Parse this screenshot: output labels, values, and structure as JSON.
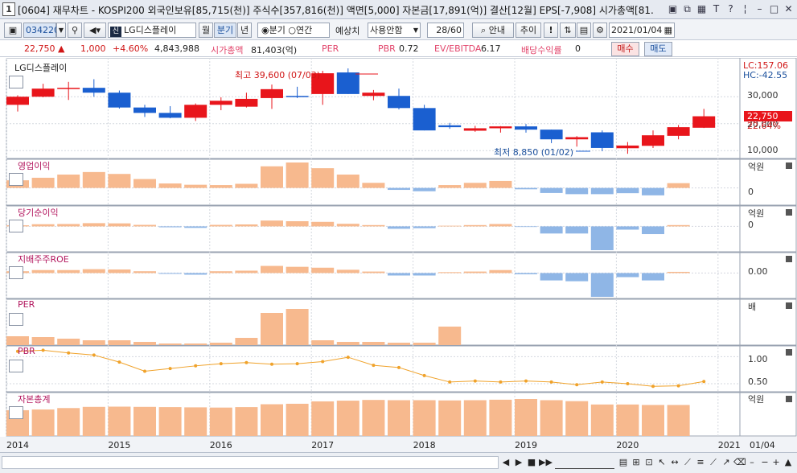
{
  "titlebar": {
    "window_number": "1",
    "title": "[0604] 재무차트 - KOSPI200 외국인보유[85,715(천)] 주식수[357,816(천)] 액면[5,000] 자본금[17,891(억)] 결산[12월] EPS[-7,908] 시가총액[81."
  },
  "toolbar": {
    "stock_code": "034220",
    "stock_name": "LG디스플레이",
    "period_month": "월",
    "period_quarter": "분기",
    "period_year": "년",
    "radio_quarter": "분기",
    "radio_year": "연간",
    "forecast_label": "예상치",
    "forecast_value": "사용안함",
    "count_value": "28",
    "count_total": "/60",
    "guide_label": "안내",
    "add_label": "추이",
    "date_value": "2021/01/04"
  },
  "infobar": {
    "price": "22,750",
    "change": "1,000",
    "change_pct": "+4.60%",
    "volume": "4,843,988",
    "mcap_label": "시가총액",
    "mcap_value": "81,403(억)",
    "per_label": "PER",
    "pbr_label": "PBR",
    "pbr_value": "0.72",
    "ev_label": "EV/EBITDA",
    "ev_value": "6.17",
    "div_label": "배당수익률",
    "div_value": "0",
    "buy_label": "매수",
    "sell_label": "매도"
  },
  "price_panel": {
    "title": "LG디스플레이",
    "lc_label": "LC:157.06",
    "hc_label": "HC:-42.55",
    "high_annotation": "최고 39,600 (07/03)",
    "low_annotation": "최저 8,850 (01/02)",
    "current_price_tag": "22,750",
    "current_pct_tag": "22.64%",
    "y_ticks": [
      "30,000",
      "20,000",
      "10,000"
    ]
  },
  "panels": [
    {
      "label": "영업이익",
      "unit": "억원",
      "zero": "0"
    },
    {
      "label": "당기순이익",
      "unit": "억원",
      "zero": "0"
    },
    {
      "label": "지배주주ROE",
      "unit": "",
      "zero": "0.00"
    },
    {
      "label": "PER",
      "unit": "배",
      "zero": ""
    },
    {
      "label": "PBR",
      "unit": "",
      "tick_hi": "1.00",
      "tick_lo": "0.50"
    },
    {
      "label": "자본총계",
      "unit": "억원",
      "zero": ""
    }
  ],
  "x_axis": [
    "2014",
    "2015",
    "2016",
    "2017",
    "2018",
    "2019",
    "2020",
    "2021"
  ],
  "x_axis_end": "01/04",
  "colors": {
    "up": "#e8151b",
    "down": "#1a5fd0",
    "bar_pos": "#f7b98e",
    "bar_neg": "#8fb6e6",
    "line": "#f0a22a"
  },
  "chart_data": [
    {
      "type": "candlestick",
      "title": "LG디스플레이 quarterly price",
      "categories": [
        "2014Q1",
        "2014Q2",
        "2014Q3",
        "2014Q4",
        "2015Q1",
        "2015Q2",
        "2015Q3",
        "2015Q4",
        "2016Q1",
        "2016Q2",
        "2016Q3",
        "2016Q4",
        "2017Q1",
        "2017Q2",
        "2017Q3",
        "2017Q4",
        "2018Q1",
        "2018Q2",
        "2018Q3",
        "2018Q4",
        "2019Q1",
        "2019Q2",
        "2019Q3",
        "2019Q4",
        "2020Q1",
        "2020Q2",
        "2020Q3",
        "2020Q4",
        "2021Q1"
      ],
      "ohlc": [
        [
          27000,
          30500,
          24500,
          30000
        ],
        [
          30000,
          34800,
          29800,
          33000
        ],
        [
          33000,
          35500,
          28800,
          33300
        ],
        [
          33300,
          36500,
          30000,
          31500
        ],
        [
          31500,
          32300,
          25600,
          26000
        ],
        [
          26000,
          27000,
          22500,
          24000
        ],
        [
          24000,
          26500,
          22000,
          22200
        ],
        [
          22200,
          27500,
          21000,
          27000
        ],
        [
          27000,
          29800,
          25000,
          28500
        ],
        [
          26300,
          31500,
          26000,
          29200
        ],
        [
          29500,
          34500,
          25500,
          32800
        ],
        [
          30300,
          33700,
          29500,
          30000
        ],
        [
          31000,
          39600,
          27000,
          38700
        ],
        [
          39000,
          40500,
          31000,
          31000
        ],
        [
          30300,
          32500,
          28700,
          31500
        ],
        [
          30300,
          33000,
          25300,
          25800
        ],
        [
          25800,
          27000,
          17500,
          17500
        ],
        [
          19400,
          20300,
          18100,
          18700
        ],
        [
          17400,
          19200,
          17000,
          18300
        ],
        [
          18300,
          19100,
          16700,
          19000
        ],
        [
          19000,
          19900,
          16700,
          17800
        ],
        [
          17800,
          17800,
          12800,
          14200
        ],
        [
          14200,
          15400,
          11500,
          15000
        ],
        [
          16800,
          17500,
          9800,
          11000
        ],
        [
          10900,
          13200,
          8850,
          11900
        ],
        [
          11800,
          17500,
          11000,
          15700
        ],
        [
          15500,
          19500,
          14200,
          18700
        ],
        [
          18500,
          25500,
          18400,
          22750
        ]
      ],
      "ylim": [
        8000,
        42000
      ]
    },
    {
      "type": "bar",
      "title": "영업이익",
      "categories": [
        "2014Q1",
        "2014Q2",
        "2014Q3",
        "2014Q4",
        "2015Q1",
        "2015Q2",
        "2015Q3",
        "2015Q4",
        "2016Q1",
        "2016Q2",
        "2016Q3",
        "2016Q4",
        "2017Q1",
        "2017Q2",
        "2017Q3",
        "2017Q4",
        "2018Q1",
        "2018Q2",
        "2018Q3",
        "2018Q4",
        "2019Q1",
        "2019Q2",
        "2019Q3",
        "2019Q4",
        "2020Q1",
        "2020Q2",
        "2020Q3",
        "2020Q4"
      ],
      "values": [
        1200,
        1600,
        2100,
        2500,
        2200,
        1400,
        700,
        500,
        450,
        650,
        3400,
        4000,
        3100,
        2100,
        800,
        -500,
        -850,
        450,
        800,
        1100,
        -350,
        -1300,
        -1600,
        -1600,
        -1350,
        -1900,
        750,
        0
      ]
    },
    {
      "type": "bar",
      "title": "당기순이익",
      "categories": [
        "2014Q1",
        "2014Q2",
        "2014Q3",
        "2014Q4",
        "2015Q1",
        "2015Q2",
        "2015Q3",
        "2015Q4",
        "2016Q1",
        "2016Q2",
        "2016Q3",
        "2016Q4",
        "2017Q1",
        "2017Q2",
        "2017Q3",
        "2017Q4",
        "2018Q1",
        "2018Q2",
        "2018Q3",
        "2018Q4",
        "2019Q1",
        "2019Q2",
        "2019Q3",
        "2019Q4",
        "2020Q1",
        "2020Q2",
        "2020Q3",
        "2020Q4"
      ],
      "values": [
        250,
        500,
        550,
        750,
        700,
        350,
        -150,
        -250,
        350,
        450,
        1350,
        1200,
        1050,
        600,
        300,
        -400,
        -300,
        150,
        300,
        550,
        -100,
        -1200,
        -1200,
        -4000,
        -550,
        -1300,
        300,
        0
      ]
    },
    {
      "type": "bar",
      "title": "지배주주ROE",
      "categories": [
        "2014Q1",
        "2014Q2",
        "2014Q3",
        "2014Q4",
        "2015Q1",
        "2015Q2",
        "2015Q3",
        "2015Q4",
        "2016Q1",
        "2016Q2",
        "2016Q3",
        "2016Q4",
        "2017Q1",
        "2017Q2",
        "2017Q3",
        "2017Q4",
        "2018Q1",
        "2018Q2",
        "2018Q3",
        "2018Q4",
        "2019Q1",
        "2019Q2",
        "2019Q3",
        "2019Q4",
        "2020Q1",
        "2020Q2",
        "2020Q3",
        "2020Q4"
      ],
      "values": [
        3.0,
        5.0,
        5.0,
        6.5,
        6.0,
        3.0,
        -1.0,
        -2.0,
        3.0,
        4.0,
        12.0,
        10.5,
        9.0,
        5.5,
        2.5,
        -3.0,
        -3.0,
        1.5,
        2.5,
        5.0,
        -1.5,
        -9.0,
        -10.0,
        -29.0,
        -5.0,
        -9.0,
        2.0,
        0
      ]
    },
    {
      "type": "bar",
      "title": "PER",
      "categories": [
        "2014Q1",
        "2014Q2",
        "2014Q3",
        "2014Q4",
        "2015Q1",
        "2015Q2",
        "2015Q3",
        "2015Q4",
        "2016Q1",
        "2016Q2",
        "2016Q3",
        "2016Q4",
        "2017Q1",
        "2017Q2",
        "2017Q3",
        "2017Q4",
        "2018Q1",
        "2018Q2",
        "2018Q3",
        "2018Q4",
        "2019Q1",
        "2019Q2",
        "2019Q3",
        "2019Q4",
        "2020Q1",
        "2020Q2",
        "2020Q3",
        "2020Q4"
      ],
      "values": [
        11,
        10,
        8,
        6,
        6,
        4,
        2,
        2,
        3,
        9,
        40,
        45,
        6,
        4,
        4,
        3,
        3,
        23,
        0,
        0,
        0,
        0,
        0,
        0,
        0,
        0,
        0,
        0
      ]
    },
    {
      "type": "line",
      "title": "PBR",
      "categories": [
        "2014Q1",
        "2014Q2",
        "2014Q3",
        "2014Q4",
        "2015Q1",
        "2015Q2",
        "2015Q3",
        "2015Q4",
        "2016Q1",
        "2016Q2",
        "2016Q3",
        "2016Q4",
        "2017Q1",
        "2017Q2",
        "2017Q3",
        "2017Q4",
        "2018Q1",
        "2018Q2",
        "2018Q3",
        "2018Q4",
        "2019Q1",
        "2019Q2",
        "2019Q3",
        "2019Q4",
        "2020Q1",
        "2020Q2",
        "2020Q3",
        "2020Q4"
      ],
      "values": [
        1.1,
        1.12,
        1.07,
        1.03,
        0.9,
        0.73,
        0.78,
        0.83,
        0.87,
        0.89,
        0.86,
        0.87,
        0.91,
        0.99,
        0.84,
        0.8,
        0.65,
        0.53,
        0.55,
        0.53,
        0.55,
        0.53,
        0.48,
        0.53,
        0.5,
        0.45,
        0.46,
        0.54
      ],
      "ylim": [
        0.35,
        1.2
      ]
    },
    {
      "type": "bar",
      "title": "자본총계",
      "categories": [
        "2014Q1",
        "2014Q2",
        "2014Q3",
        "2014Q4",
        "2015Q1",
        "2015Q2",
        "2015Q3",
        "2015Q4",
        "2016Q1",
        "2016Q2",
        "2016Q3",
        "2016Q4",
        "2017Q1",
        "2017Q2",
        "2017Q3",
        "2017Q4",
        "2018Q1",
        "2018Q2",
        "2018Q3",
        "2018Q4",
        "2019Q1",
        "2019Q2",
        "2019Q3",
        "2019Q4",
        "2020Q1",
        "2020Q2",
        "2020Q3",
        "2020Q4"
      ],
      "values": [
        108000,
        111000,
        117000,
        122000,
        123000,
        122000,
        121000,
        120000,
        119000,
        121000,
        133000,
        135000,
        145000,
        148000,
        151000,
        150000,
        150000,
        149000,
        150000,
        152000,
        155000,
        150000,
        146000,
        132000,
        132000,
        130000,
        130000,
        0
      ]
    }
  ]
}
